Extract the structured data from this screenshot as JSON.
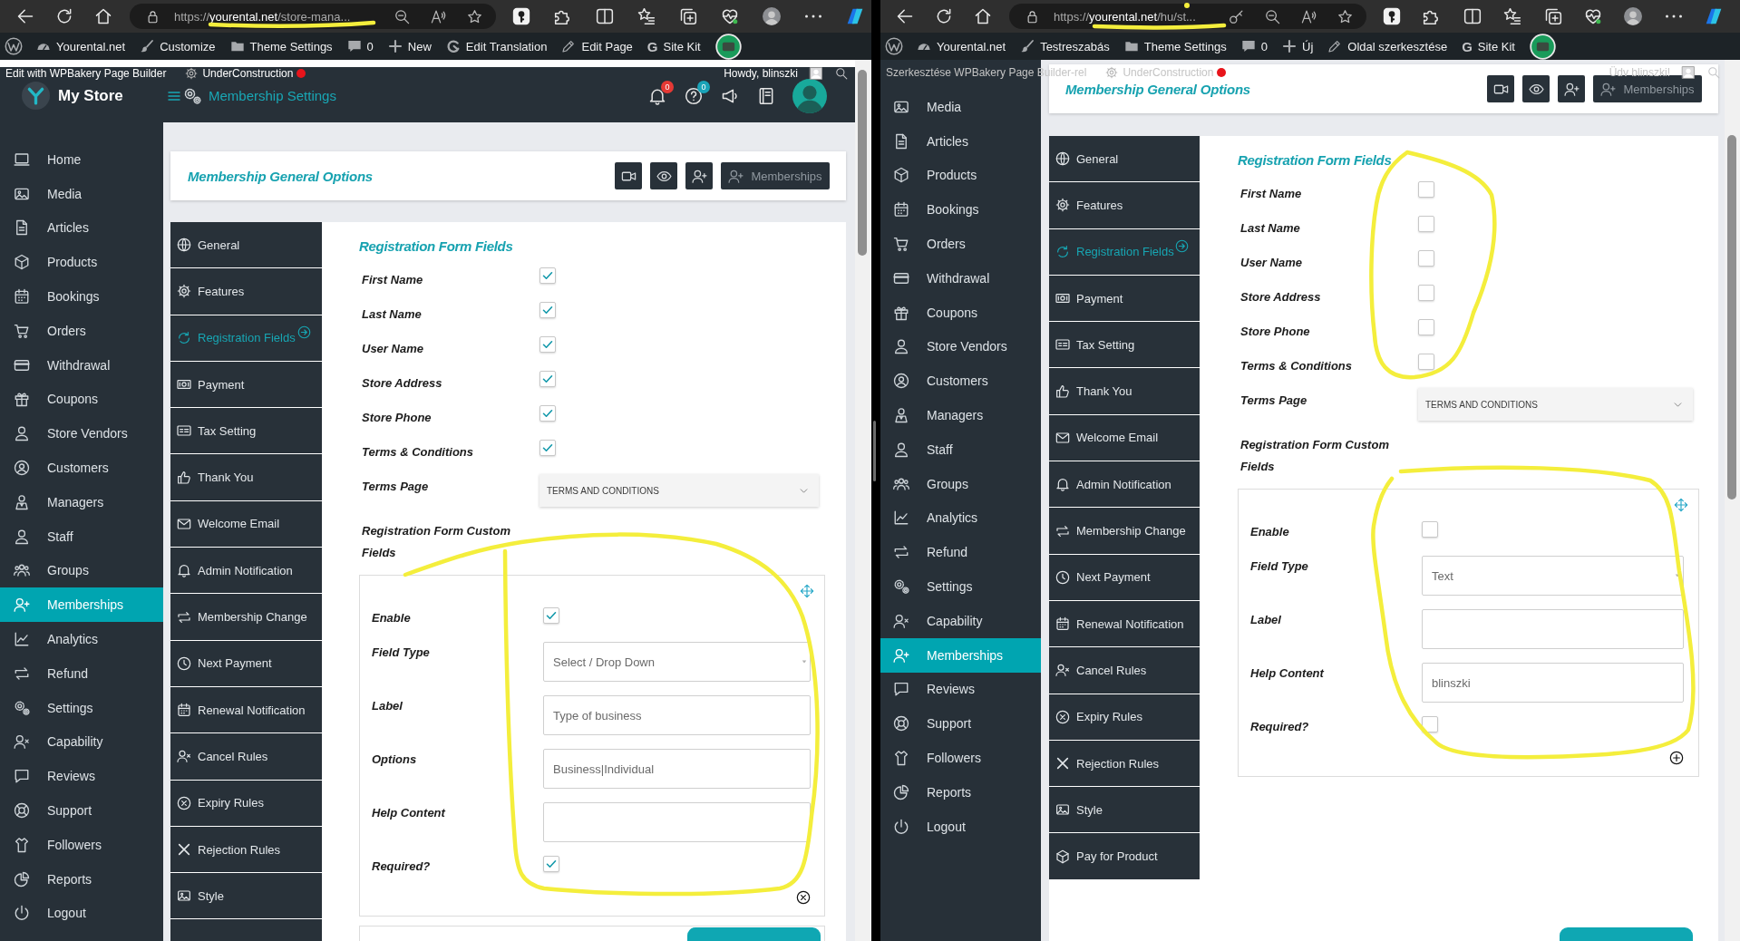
{
  "windows": [
    {
      "browser": {
        "url": "https://**yourental.net**/store-mana..."
      },
      "admin_bar": {
        "items": [
          {
            "label": "Yourental.net"
          },
          {
            "label": "Customize"
          },
          {
            "label": "Theme Settings"
          },
          {
            "label": "0"
          },
          {
            "label": "New"
          },
          {
            "label": "Edit Translation"
          },
          {
            "label": "Edit Page"
          },
          {
            "label": "Site Kit",
            "glyph": "G"
          }
        ]
      },
      "builder_bar": {
        "builder": "Edit with WPBakery Page Builder",
        "status": "UnderConstruction",
        "greeting": "Howdy, blinszki"
      },
      "store_header": {
        "title": "My Store",
        "page": "Membership Settings",
        "notifications": "0",
        "help": "0"
      },
      "sidebar": {
        "items": [
          {
            "label": "Home",
            "selected": false
          },
          {
            "label": "Media",
            "selected": false
          },
          {
            "label": "Articles",
            "selected": false
          },
          {
            "label": "Products",
            "selected": false
          },
          {
            "label": "Bookings",
            "selected": false
          },
          {
            "label": "Orders",
            "selected": false
          },
          {
            "label": "Withdrawal",
            "selected": false
          },
          {
            "label": "Coupons",
            "selected": false
          },
          {
            "label": "Store Vendors",
            "selected": false
          },
          {
            "label": "Customers",
            "selected": false
          },
          {
            "label": "Managers",
            "selected": false
          },
          {
            "label": "Staff",
            "selected": false
          },
          {
            "label": "Groups",
            "selected": false
          },
          {
            "label": "Memberships",
            "selected": true
          },
          {
            "label": "Analytics",
            "selected": false
          },
          {
            "label": "Refund",
            "selected": false
          },
          {
            "label": "Settings",
            "selected": false
          },
          {
            "label": "Capability",
            "selected": false
          },
          {
            "label": "Reviews",
            "selected": false
          },
          {
            "label": "Support",
            "selected": false
          },
          {
            "label": "Followers",
            "selected": false
          },
          {
            "label": "Reports",
            "selected": false
          },
          {
            "label": "Logout",
            "selected": false
          }
        ]
      },
      "page_card": {
        "title": "Membership General Options",
        "button": "Memberships"
      },
      "tabs": [
        {
          "label": "General",
          "selected": false
        },
        {
          "label": "Features",
          "selected": false
        },
        {
          "label": "Registration Fields",
          "selected": true
        },
        {
          "label": "Payment",
          "selected": false
        },
        {
          "label": "Tax Setting",
          "selected": false
        },
        {
          "label": "Thank You",
          "selected": false
        },
        {
          "label": "Welcome Email",
          "selected": false
        },
        {
          "label": "Admin Notification",
          "selected": false
        },
        {
          "label": "Membership Change",
          "selected": false
        },
        {
          "label": "Next Payment",
          "selected": false
        },
        {
          "label": "Renewal Notification",
          "selected": false
        },
        {
          "label": "Cancel Rules",
          "selected": false
        },
        {
          "label": "Expiry Rules",
          "selected": false
        },
        {
          "label": "Rejection Rules",
          "selected": false
        },
        {
          "label": "Style",
          "selected": false
        }
      ],
      "form": {
        "heading": "Registration Form Fields",
        "fields": [
          {
            "label": "First Name",
            "checked": true
          },
          {
            "label": "Last Name",
            "checked": true
          },
          {
            "label": "User Name",
            "checked": true
          },
          {
            "label": "Store Address",
            "checked": true
          },
          {
            "label": "Store Phone",
            "checked": true
          },
          {
            "label": "Terms & Conditions",
            "checked": true
          }
        ],
        "terms_page": {
          "label": "Terms Page",
          "value": "TERMS AND CONDITIONS"
        },
        "custom_heading": "Registration Form Custom Fields",
        "custom_fields": [
          {
            "kind": "checkbox",
            "label": "Enable",
            "checked": true
          },
          {
            "kind": "select",
            "label": "Field Type",
            "value": "Select / Drop Down"
          },
          {
            "kind": "input",
            "label": "Label",
            "value": "Type of business"
          },
          {
            "kind": "input",
            "label": "Options",
            "value": "Business|Individual"
          },
          {
            "kind": "input",
            "label": "Help Content"
          },
          {
            "kind": "checkbox",
            "label": "Required?",
            "checked": true
          }
        ]
      }
    },
    {
      "browser": {
        "url": "https://**yourental.net**/hu/st...",
        "password_icon": true
      },
      "admin_bar": {
        "items": [
          {
            "label": "Yourental.net"
          },
          {
            "label": "Testreszabás"
          },
          {
            "label": "Theme Settings"
          },
          {
            "label": "0"
          },
          {
            "label": "Új"
          },
          {
            "label": "Oldal szerkesztése"
          },
          {
            "label": "Site Kit",
            "glyph": "G"
          }
        ]
      },
      "builder_bar": {
        "builder": "Szerkesztése WPBakery Page Builder-rel",
        "status": "UnderConstruction",
        "greeting": "Üdv blinszki!"
      },
      "sidebar": {
        "items": [
          {
            "label": "Media",
            "selected": false
          },
          {
            "label": "Articles",
            "selected": false
          },
          {
            "label": "Products",
            "selected": false
          },
          {
            "label": "Bookings",
            "selected": false
          },
          {
            "label": "Orders",
            "selected": false
          },
          {
            "label": "Withdrawal",
            "selected": false
          },
          {
            "label": "Coupons",
            "selected": false
          },
          {
            "label": "Store Vendors",
            "selected": false
          },
          {
            "label": "Customers",
            "selected": false
          },
          {
            "label": "Managers",
            "selected": false
          },
          {
            "label": "Staff",
            "selected": false
          },
          {
            "label": "Groups",
            "selected": false
          },
          {
            "label": "Analytics",
            "selected": false
          },
          {
            "label": "Refund",
            "selected": false
          },
          {
            "label": "Settings",
            "selected": false
          },
          {
            "label": "Capability",
            "selected": false
          },
          {
            "label": "Memberships",
            "selected": true
          },
          {
            "label": "Reviews",
            "selected": false
          },
          {
            "label": "Support",
            "selected": false
          },
          {
            "label": "Followers",
            "selected": false
          },
          {
            "label": "Reports",
            "selected": false
          },
          {
            "label": "Logout",
            "selected": false
          }
        ]
      },
      "page_card": {
        "title": "Membership General Options",
        "button": "Memberships"
      },
      "tabs": [
        {
          "label": "General",
          "selected": false
        },
        {
          "label": "Features",
          "selected": false
        },
        {
          "label": "Registration Fields",
          "selected": true
        },
        {
          "label": "Payment",
          "selected": false
        },
        {
          "label": "Tax Setting",
          "selected": false
        },
        {
          "label": "Thank You",
          "selected": false
        },
        {
          "label": "Welcome Email",
          "selected": false
        },
        {
          "label": "Admin Notification",
          "selected": false
        },
        {
          "label": "Membership Change",
          "selected": false
        },
        {
          "label": "Next Payment",
          "selected": false
        },
        {
          "label": "Renewal Notification",
          "selected": false
        },
        {
          "label": "Cancel Rules",
          "selected": false
        },
        {
          "label": "Expiry Rules",
          "selected": false
        },
        {
          "label": "Rejection Rules",
          "selected": false
        },
        {
          "label": "Style",
          "selected": false
        },
        {
          "label": "Pay for Product",
          "selected": false
        }
      ],
      "form": {
        "heading": "Registration Form Fields",
        "fields": [
          {
            "label": "First Name",
            "checked": false
          },
          {
            "label": "Last Name",
            "checked": false
          },
          {
            "label": "User Name",
            "checked": false
          },
          {
            "label": "Store Address",
            "checked": false
          },
          {
            "label": "Store Phone",
            "checked": false
          },
          {
            "label": "Terms & Conditions",
            "checked": false
          }
        ],
        "terms_page": {
          "label": "Terms Page",
          "value": "TERMS AND CONDITIONS"
        },
        "custom_heading": "Registration Form Custom Fields",
        "custom_fields": [
          {
            "kind": "checkbox",
            "label": "Enable",
            "checked": false
          },
          {
            "kind": "select",
            "label": "Field Type",
            "value": "Text"
          },
          {
            "kind": "input",
            "label": "Label"
          },
          {
            "kind": "input",
            "label": "Help Content",
            "value": "blinszki"
          },
          {
            "kind": "checkbox",
            "label": "Required?",
            "checked": false
          }
        ]
      }
    }
  ]
}
